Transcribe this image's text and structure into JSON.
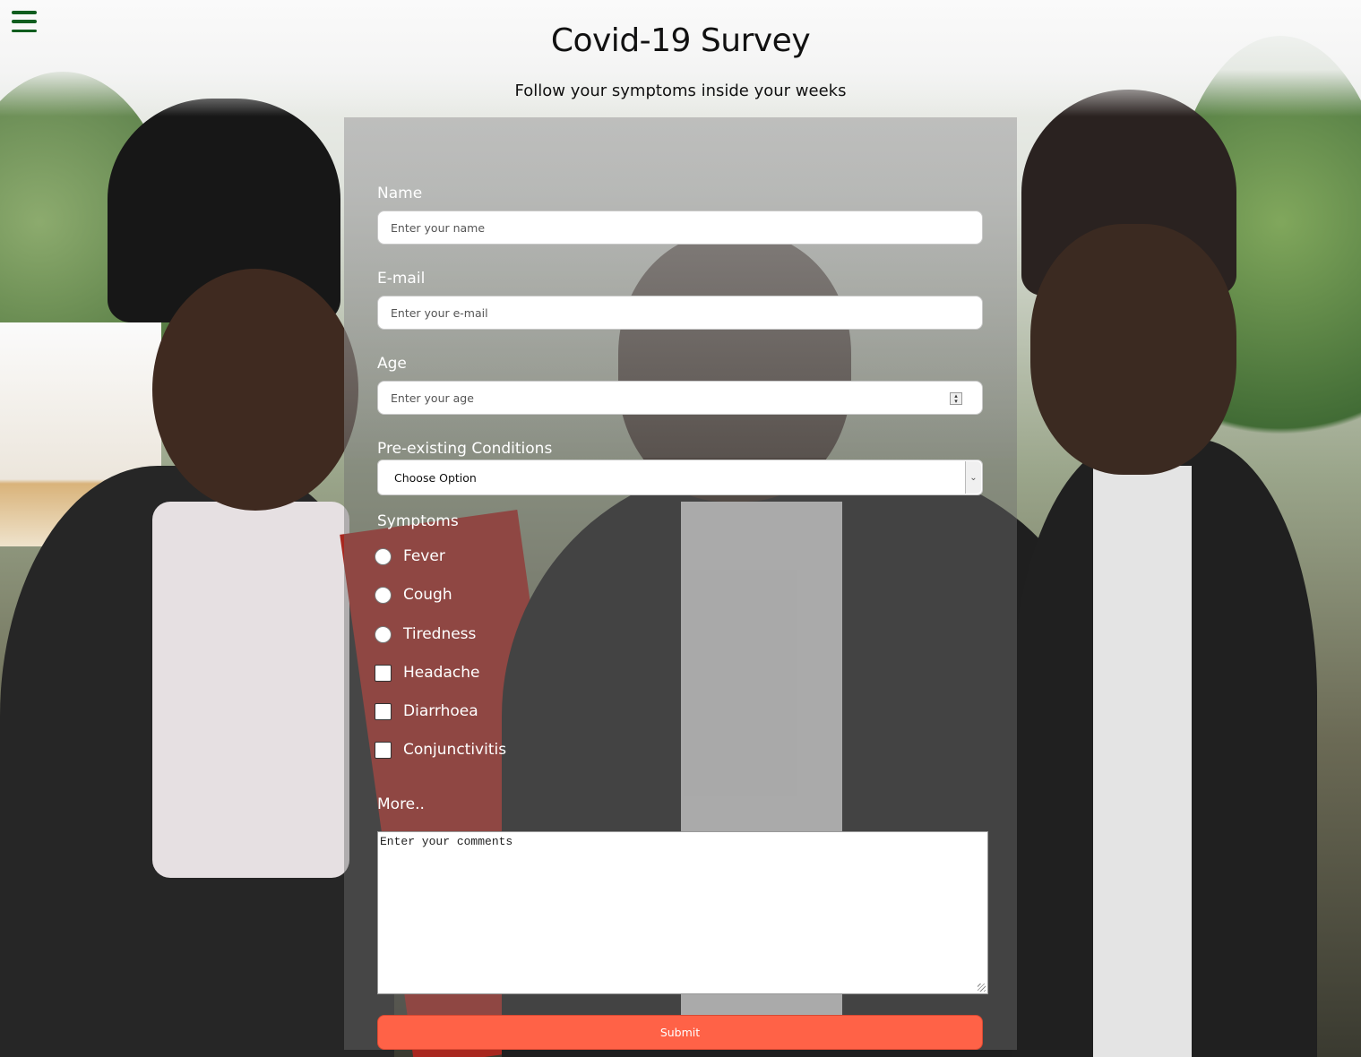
{
  "header": {
    "title": "Covid-19 Survey",
    "subtitle": "Follow your symptoms inside your weeks",
    "menu_icon": "hamburger-menu-icon"
  },
  "form": {
    "name": {
      "label": "Name",
      "placeholder": "Enter your name"
    },
    "email": {
      "label": "E-mail",
      "placeholder": "Enter your e-mail"
    },
    "age": {
      "label": "Age",
      "placeholder": "Enter your age"
    },
    "conditions": {
      "label": "Pre-existing Conditions",
      "selected": "Choose Option"
    },
    "symptoms": {
      "label": "Symptoms",
      "radios": [
        "Fever",
        "Cough",
        "Tiredness"
      ],
      "checkboxes": [
        "Headache",
        "Diarrhoea",
        "Conjunctivitis"
      ]
    },
    "more": {
      "label": "More..",
      "placeholder": "Enter your comments"
    },
    "submit_label": "Submit"
  },
  "colors": {
    "menu_icon": "#0f5d1e",
    "submit_button": "#ff6247"
  }
}
